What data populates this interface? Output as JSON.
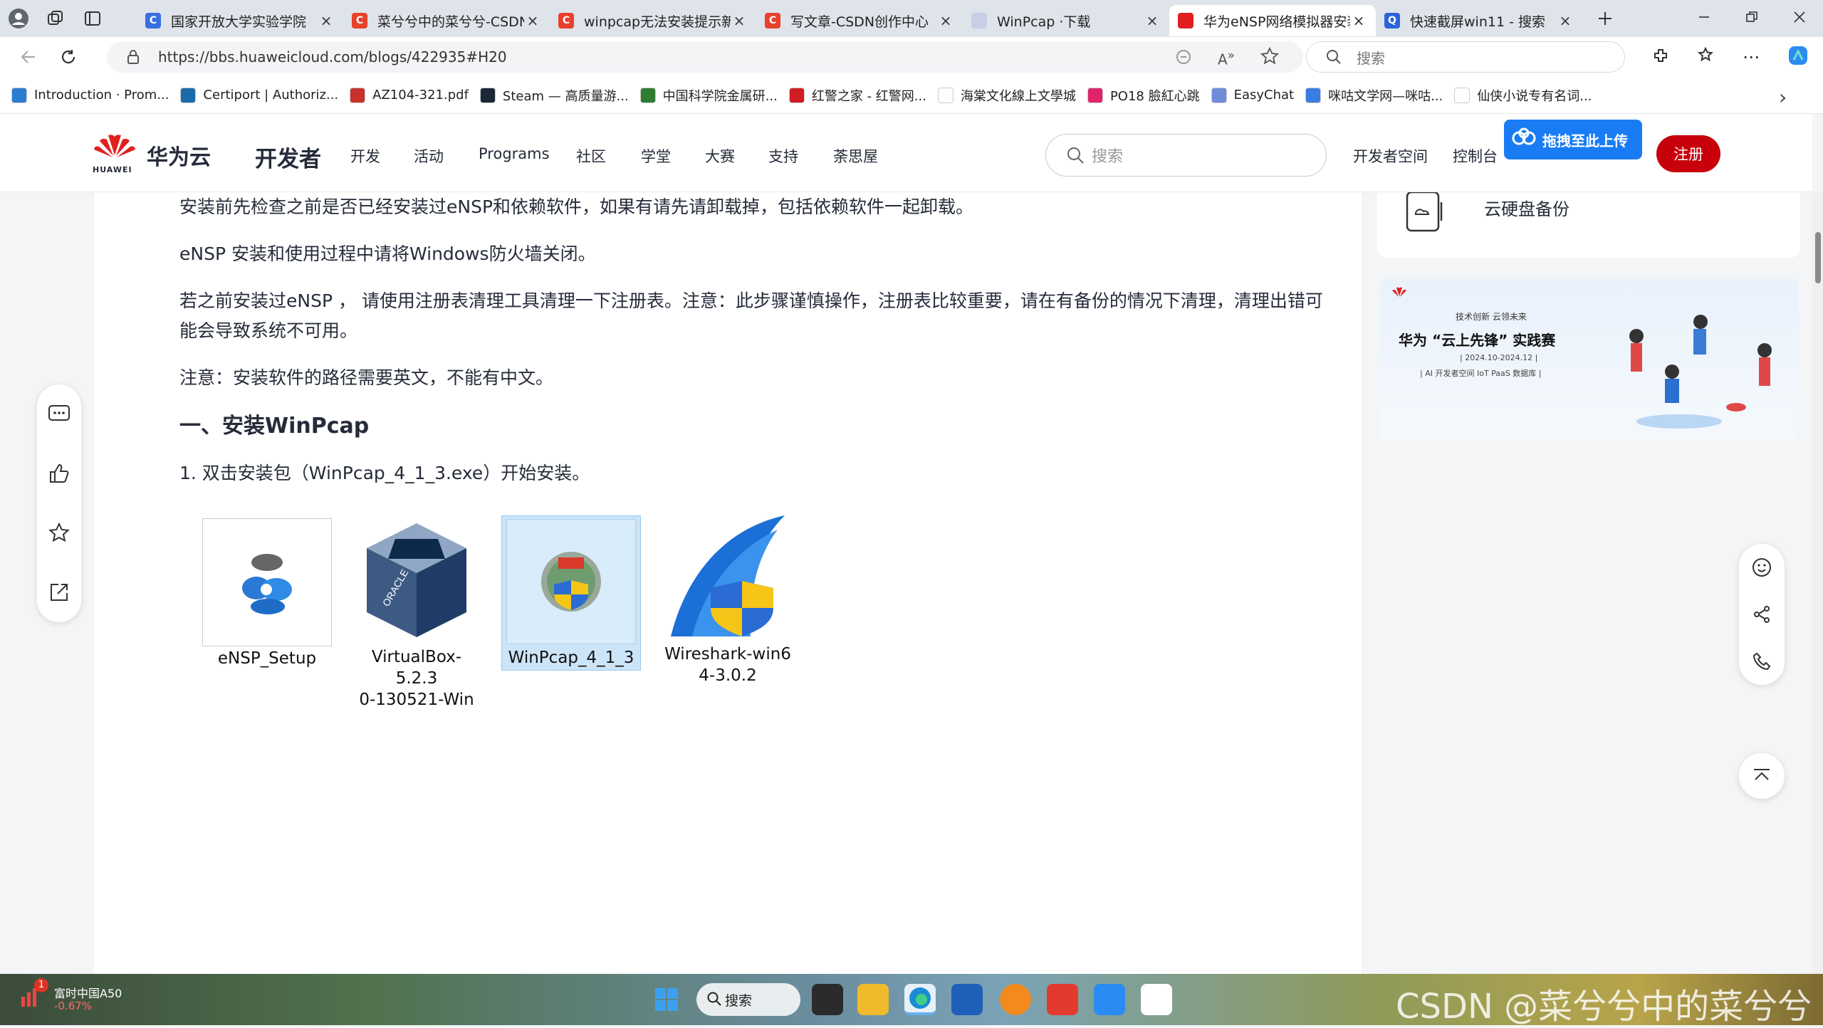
{
  "browser": {
    "tabs": [
      {
        "title": "国家开放大学实验学院",
        "fav_color": "#3b6fe0",
        "fav_glyph": "C"
      },
      {
        "title": "菜兮兮中的菜兮兮-CSDN",
        "fav_color": "#e8412c",
        "fav_glyph": "C"
      },
      {
        "title": "winpcap无法安装提示新",
        "fav_color": "#e8412c",
        "fav_glyph": "C"
      },
      {
        "title": "写文章-CSDN创作中心",
        "fav_color": "#e8412c",
        "fav_glyph": "C"
      },
      {
        "title": "WinPcap ·下载",
        "fav_color": "#c6cfe6",
        "fav_glyph": ""
      },
      {
        "title": "华为eNSP网络模拟器安装",
        "fav_color": "#e02020",
        "fav_glyph": ""
      },
      {
        "title": "快速截屏win11 - 搜索",
        "fav_color": "#2d64d8",
        "fav_glyph": "Q"
      }
    ],
    "url": "https://bbs.huaweicloud.com/blogs/422935#H20",
    "search_placeholder": "搜索",
    "bookmarks": [
      {
        "label": "Introduction · Prom...",
        "color": "#2c7cd1"
      },
      {
        "label": "Certiport | Authoriz...",
        "color": "#1c6aa8"
      },
      {
        "label": "AZ104-321.pdf",
        "color": "#c9322c"
      },
      {
        "label": "Steam — 高质量游...",
        "color": "#1b2838"
      },
      {
        "label": "中国科学院金属研...",
        "color": "#2f7d32"
      },
      {
        "label": "红警之家 - 红警网...",
        "color": "#d11c24"
      },
      {
        "label": "海棠文化線上文學城",
        "color": "#ffffff"
      },
      {
        "label": "PO18 臉紅心跳",
        "color": "#e0246b"
      },
      {
        "label": "EasyChat",
        "color": "#6f8cd9"
      },
      {
        "label": "咪咕文学网—咪咕...",
        "color": "#3a7de0"
      },
      {
        "label": "仙侠小说专有名词...",
        "color": "#ffffff"
      }
    ]
  },
  "site": {
    "brand": "华为云",
    "brand_sub": "HUAWEI",
    "section": "开发者",
    "nav": [
      "开发",
      "活动",
      "Programs",
      "社区",
      "学堂",
      "大赛",
      "支持",
      "荼思屋"
    ],
    "search_placeholder": "搜索",
    "dev_space": "开发者空间",
    "console": "控制台",
    "register": "注册",
    "baidu_upload": "拖拽至此上传"
  },
  "article": {
    "p1": "安装前先检查之前是否已经安装过eNSP和依赖软件，如果有请先请卸载掉，包括依赖软件一起卸载。",
    "p2": "eNSP 安装和使用过程中请将Windows防火墙关闭。",
    "p3a": "若之前安装过eNSP ， 请使用注册表清理工具清理一下注册表。注意：此步骤谨慎操作，注册表比较重要，请在有备份的情况下清理，清理出错可",
    "p3b": "能会导致系统不可用。",
    "p4": "注意：安装软件的路径需要英文，不能有中文。",
    "h1": "一、安装WinPcap",
    "step1": "1. 双击安装包（WinPcap_4_1_3.exe）开始安装。",
    "files": [
      {
        "line1": "eNSP_Setup",
        "line2": ""
      },
      {
        "line1": "VirtualBox-5.2.3",
        "line2": "0-130521-Win"
      },
      {
        "line1": "WinPcap_4_1_3",
        "line2": ""
      },
      {
        "line1": "Wireshark-win6",
        "line2": "4-3.0.2"
      }
    ]
  },
  "sidebar": {
    "cloud_backup": "云硬盘备份",
    "banner_line1": "技术创新 云领未来",
    "banner_line2": "华为 “云上先锋” 实践赛",
    "banner_line3": "| 2024.10-2024.12 |",
    "banner_line4": "| AI 开发者空间 IoT PaaS 数据库 |"
  },
  "taskbar": {
    "stock_name": "富时中国A50",
    "stock_change": "-0.67%",
    "stock_badge": "1",
    "search_label": "搜索",
    "watermark": "CSDN @菜兮兮中的菜兮兮"
  }
}
